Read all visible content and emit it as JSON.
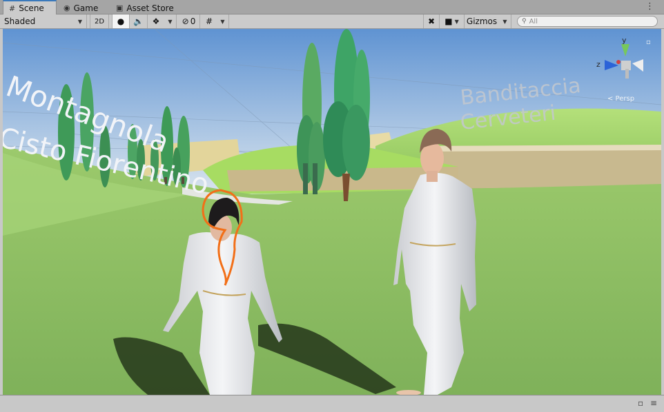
{
  "tabs": [
    {
      "icon": "grid-icon",
      "label": "Scene",
      "active": true
    },
    {
      "icon": "gamepad-icon",
      "label": "Game",
      "active": false
    },
    {
      "icon": "bag-icon",
      "label": "Asset Store",
      "active": false
    }
  ],
  "toolbar": {
    "draw_mode": "Shaded",
    "mode_2d": "2D",
    "hidden_count": "0",
    "gizmos_label": "Gizmos",
    "search_placeholder": "All"
  },
  "scene": {
    "signs": [
      "Montagnola",
      "Cisto Fiorentino",
      "Banditaccia",
      "Cerveteri"
    ],
    "gizmo": {
      "y_label": "y",
      "z_label": "z",
      "projection": "< Persp"
    }
  },
  "colors": {
    "tab_accent": "#3a79bb",
    "selection_outline": "#f26f18",
    "sky": "#6f9fd6",
    "grass": "#88bb5e"
  }
}
